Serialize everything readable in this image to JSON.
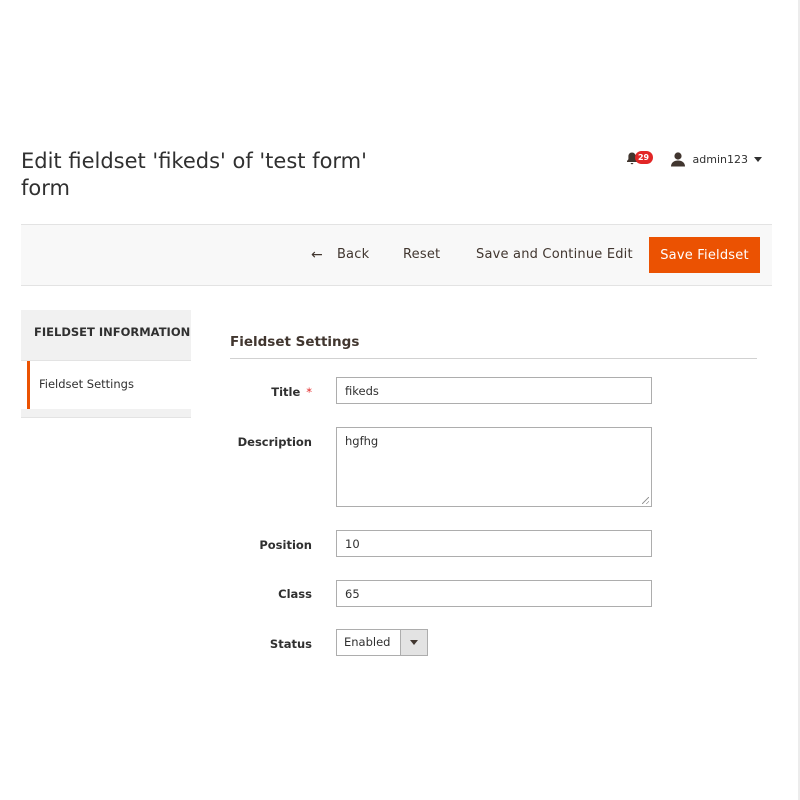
{
  "header": {
    "title": "Edit fieldset 'fikeds' of 'test form' form",
    "notifications_count": "29",
    "username": "admin123"
  },
  "toolbar": {
    "back_label": "Back",
    "reset_label": "Reset",
    "save_continue_label": "Save and Continue Edit",
    "save_label": "Save Fieldset"
  },
  "sidebar": {
    "title": "FIELDSET INFORMATION",
    "items": [
      {
        "label": "Fieldset Settings",
        "active": true
      }
    ]
  },
  "form": {
    "section_title": "Fieldset Settings",
    "fields": {
      "title": {
        "label": "Title",
        "value": "fikeds",
        "required": true
      },
      "description": {
        "label": "Description",
        "value": "hgfhg"
      },
      "position": {
        "label": "Position",
        "value": "10"
      },
      "class": {
        "label": "Class",
        "value": "65"
      },
      "status": {
        "label": "Status",
        "value": "Enabled"
      }
    }
  },
  "colors": {
    "accent": "#eb5202",
    "required": "#e22626",
    "badge": "#e22626"
  },
  "icons": {
    "notifications": "bell-icon",
    "user": "user-icon",
    "back": "arrow-left-icon",
    "dropdown": "chevron-down-icon"
  }
}
